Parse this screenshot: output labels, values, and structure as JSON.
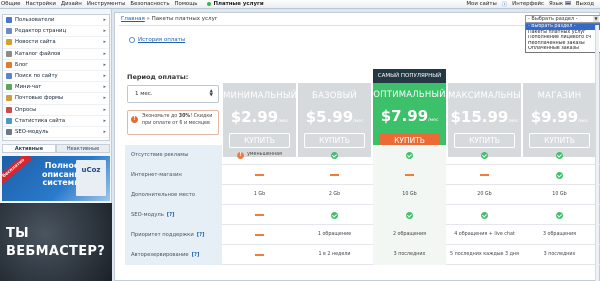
{
  "topbar": {
    "menu": [
      "Общие",
      "Настройки",
      "Дизайн",
      "Инструменты",
      "Безопасность",
      "Помощь"
    ],
    "paid": "Платные услуги",
    "my_sites": "Мои сайты",
    "interface": "Интерфейс",
    "lang": "Язык",
    "exit": "Выход"
  },
  "sidebar": {
    "items": [
      {
        "label": "Пользователи",
        "icon": "users-icon",
        "color": "#4a78c8"
      },
      {
        "label": "Редактор страниц",
        "icon": "page-editor-icon",
        "color": "#6a8cc0"
      },
      {
        "label": "Новости сайта",
        "icon": "news-icon",
        "color": "#d4a02b"
      },
      {
        "label": "Каталог файлов",
        "icon": "files-icon",
        "color": "#8b8b8b"
      },
      {
        "label": "Блог",
        "icon": "blog-icon",
        "color": "#e07b30"
      },
      {
        "label": "Поиск по сайту",
        "icon": "search-icon",
        "color": "#5a86c8"
      },
      {
        "label": "Мини-чат",
        "icon": "chat-icon",
        "color": "#59a85a"
      },
      {
        "label": "Почтовые формы",
        "icon": "mail-icon",
        "color": "#c9a040"
      },
      {
        "label": "Опросы",
        "icon": "poll-icon",
        "color": "#cf4a4a"
      },
      {
        "label": "Статистика сайта",
        "icon": "stats-icon",
        "color": "#4a9ac8"
      },
      {
        "label": "SEO-модуль",
        "icon": "seo-icon",
        "color": "#6a7a8a"
      }
    ],
    "tabs": [
      "Активные",
      "Неактивные"
    ],
    "ad1": {
      "ribbon": "бесплатно",
      "text": "Полное описание системы",
      "logo": "uCoz"
    },
    "ad2": {
      "line1": "ТЫ",
      "line2": "ВЕБМАСТЕР?"
    }
  },
  "breadcrumb": {
    "home": "Главная",
    "sep": "»",
    "current": "Пакеты платных услуг"
  },
  "history_link": "История оплаты",
  "section_select": {
    "value": "- Выбрать раздел -",
    "options": [
      "- Выбрать раздел -",
      "Пакеты платных услуг",
      "Пополнение лицевого сч",
      "Неоплаченные заказы",
      "Оплаченные заказы"
    ],
    "selected_index": 0
  },
  "period": {
    "label": "Период оплаты:",
    "value": "1 мес.",
    "savings_pre": "Экономьте до ",
    "savings_pct": "30%",
    "savings_post": "! Скидки при оплате от 6 и месяцев"
  },
  "plans": [
    {
      "name": "МИНИМАЛЬНЫЙ",
      "price": "$2.99",
      "per": "/мес",
      "buy": "КУПИТЬ",
      "featured": false
    },
    {
      "name": "БАЗОВЫЙ",
      "price": "$5.99",
      "per": "/мес",
      "buy": "КУПИТЬ",
      "featured": false
    },
    {
      "name": "ОПТИМАЛЬНЫЙ",
      "price": "$7.99",
      "per": "/мес",
      "buy": "КУПИТЬ",
      "featured": true,
      "badge": "САМЫЙ ПОПУЛЯРНЫЙ"
    },
    {
      "name": "МАКСИМАЛЬНЫЙ",
      "price": "$15.99",
      "per": "/мес",
      "buy": "КУПИТЬ",
      "featured": false
    },
    {
      "name": "МАГАЗИН",
      "price": "$9.99",
      "per": "/мес",
      "buy": "КУПИТЬ",
      "featured": false
    }
  ],
  "features": [
    {
      "name": "Отсутствие рекламы",
      "help": "",
      "cells": [
        {
          "t": "excl",
          "v": "уменьшенная"
        },
        {
          "t": "check"
        },
        {
          "t": "check"
        },
        {
          "t": "check"
        },
        {
          "t": "check"
        }
      ]
    },
    {
      "name": "Интернет-магазин",
      "help": "",
      "cells": [
        {
          "t": "dash"
        },
        {
          "t": "dash"
        },
        {
          "t": "dash"
        },
        {
          "t": "dash"
        },
        {
          "t": "check"
        }
      ]
    },
    {
      "name": "Дополнительное место",
      "help": "",
      "cells": [
        {
          "t": "text",
          "v": "1 Gb"
        },
        {
          "t": "text",
          "v": "2 Gb"
        },
        {
          "t": "text",
          "v": "10 Gb"
        },
        {
          "t": "text",
          "v": "20 Gb"
        },
        {
          "t": "text",
          "v": "10 Gb"
        }
      ]
    },
    {
      "name": "SEO-модуль",
      "help": "[?]",
      "cells": [
        {
          "t": "dash"
        },
        {
          "t": "check"
        },
        {
          "t": "check"
        },
        {
          "t": "check"
        },
        {
          "t": "check"
        }
      ]
    },
    {
      "name": "Приоритет поддержки",
      "help": "[?]",
      "cells": [
        {
          "t": "dash"
        },
        {
          "t": "text",
          "v": "1 обращение"
        },
        {
          "t": "text",
          "v": "2 обращения"
        },
        {
          "t": "text",
          "v": "4 обращения + live chat"
        },
        {
          "t": "text",
          "v": "3 обращения"
        }
      ]
    },
    {
      "name": "Авторезервирование",
      "help": "[?]",
      "cells": [
        {
          "t": "dash"
        },
        {
          "t": "text",
          "v": "1 в 2 недели"
        },
        {
          "t": "text",
          "v": "3 последних"
        },
        {
          "t": "text",
          "v": "5 последних каждые 3 дня"
        },
        {
          "t": "text",
          "v": "3 последних"
        }
      ]
    }
  ]
}
